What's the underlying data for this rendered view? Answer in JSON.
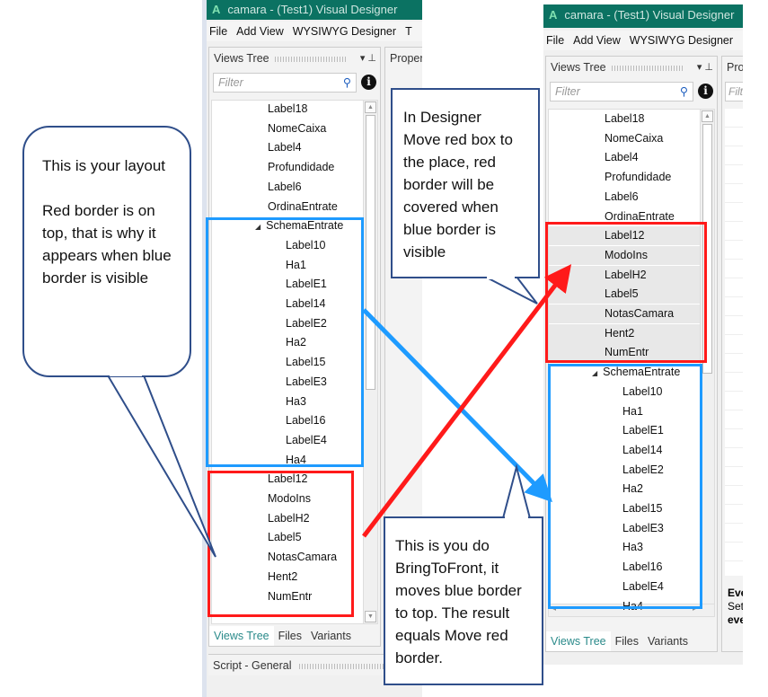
{
  "window": {
    "app_icon": "A",
    "title": "camara - (Test1) Visual Designer",
    "menu": [
      "File",
      "Add View",
      "WYSIWYG Designer",
      "T"
    ],
    "views_tree_title": "Views Tree",
    "properties_title_left": "Proper",
    "properties_title_right": "Pro",
    "filter_placeholder": "Filter",
    "properties_filter": "Filt",
    "info_icon": "i",
    "tabs": [
      "Views Tree",
      "Files",
      "Variants"
    ],
    "script_title": "Script - General",
    "events_title": "Eve",
    "events_desc_1": "Set",
    "events_desc_2": "eve"
  },
  "left_tree": [
    {
      "label": "Label18",
      "level": 0
    },
    {
      "label": "NomeCaixa",
      "level": 0
    },
    {
      "label": "Label4",
      "level": 0
    },
    {
      "label": "Profundidade",
      "level": 0
    },
    {
      "label": "Label6",
      "level": 0
    },
    {
      "label": "OrdinaEntrate",
      "level": 0
    },
    {
      "label": "SchemaEntrate",
      "level": 0,
      "expanded": true
    },
    {
      "label": "Label10",
      "level": 1
    },
    {
      "label": "Ha1",
      "level": 1
    },
    {
      "label": "LabelE1",
      "level": 1
    },
    {
      "label": "Label14",
      "level": 1
    },
    {
      "label": "LabelE2",
      "level": 1
    },
    {
      "label": "Ha2",
      "level": 1
    },
    {
      "label": "Label15",
      "level": 1
    },
    {
      "label": "LabelE3",
      "level": 1
    },
    {
      "label": "Ha3",
      "level": 1
    },
    {
      "label": "Label16",
      "level": 1
    },
    {
      "label": "LabelE4",
      "level": 1
    },
    {
      "label": "Ha4",
      "level": 1
    },
    {
      "label": "Label12",
      "level": 0
    },
    {
      "label": "ModoIns",
      "level": 0
    },
    {
      "label": "LabelH2",
      "level": 0
    },
    {
      "label": "Label5",
      "level": 0
    },
    {
      "label": "NotasCamara",
      "level": 0
    },
    {
      "label": "Hent2",
      "level": 0
    },
    {
      "label": "NumEntr",
      "level": 0
    }
  ],
  "right_tree": [
    {
      "label": "Label18",
      "level": 0
    },
    {
      "label": "NomeCaixa",
      "level": 0
    },
    {
      "label": "Label4",
      "level": 0
    },
    {
      "label": "Profundidade",
      "level": 0
    },
    {
      "label": "Label6",
      "level": 0
    },
    {
      "label": "OrdinaEntrate",
      "level": 0
    },
    {
      "label": "Label12",
      "level": 0,
      "sel": true
    },
    {
      "label": "ModoIns",
      "level": 0,
      "sel": true
    },
    {
      "label": "LabelH2",
      "level": 0,
      "sel": true
    },
    {
      "label": "Label5",
      "level": 0,
      "sel": true
    },
    {
      "label": "NotasCamara",
      "level": 0,
      "sel": true
    },
    {
      "label": "Hent2",
      "level": 0,
      "sel": true
    },
    {
      "label": "NumEntr",
      "level": 0,
      "sel": true
    },
    {
      "label": "SchemaEntrate",
      "level": 0,
      "expanded": true
    },
    {
      "label": "Label10",
      "level": 1
    },
    {
      "label": "Ha1",
      "level": 1
    },
    {
      "label": "LabelE1",
      "level": 1
    },
    {
      "label": "Label14",
      "level": 1
    },
    {
      "label": "LabelE2",
      "level": 1
    },
    {
      "label": "Ha2",
      "level": 1
    },
    {
      "label": "Label15",
      "level": 1
    },
    {
      "label": "LabelE3",
      "level": 1
    },
    {
      "label": "Ha3",
      "level": 1
    },
    {
      "label": "Label16",
      "level": 1
    },
    {
      "label": "LabelE4",
      "level": 1
    },
    {
      "label": "Ha4",
      "level": 1
    }
  ],
  "callouts": {
    "layout": "This is your layout\n\nRed border is on top, that is why it appears when blue border is visible",
    "designer": "In Designer\nMove red box to the place, red border will be covered when blue border is visible",
    "bring_to_front": "This is you do BringToFront, it moves blue border to top. The result equals Move red border."
  },
  "colors": {
    "titlebar": "#0b7262",
    "red": "#ff1a1a",
    "blue": "#1e9bff",
    "callout_border": "#2f4e8a"
  }
}
